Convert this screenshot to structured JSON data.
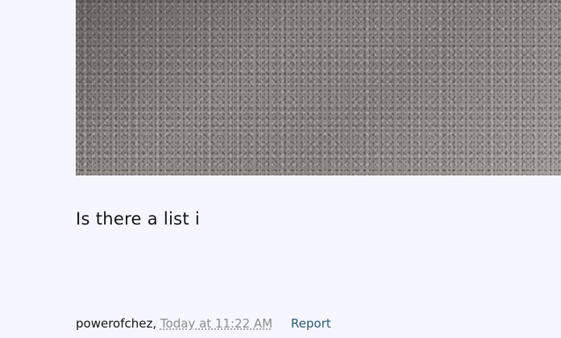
{
  "post": {
    "body_text": "Is there a list i",
    "author": "powerofchez",
    "separator": ",",
    "timestamp": "Today at 11:22 AM",
    "report_label": "Report"
  }
}
